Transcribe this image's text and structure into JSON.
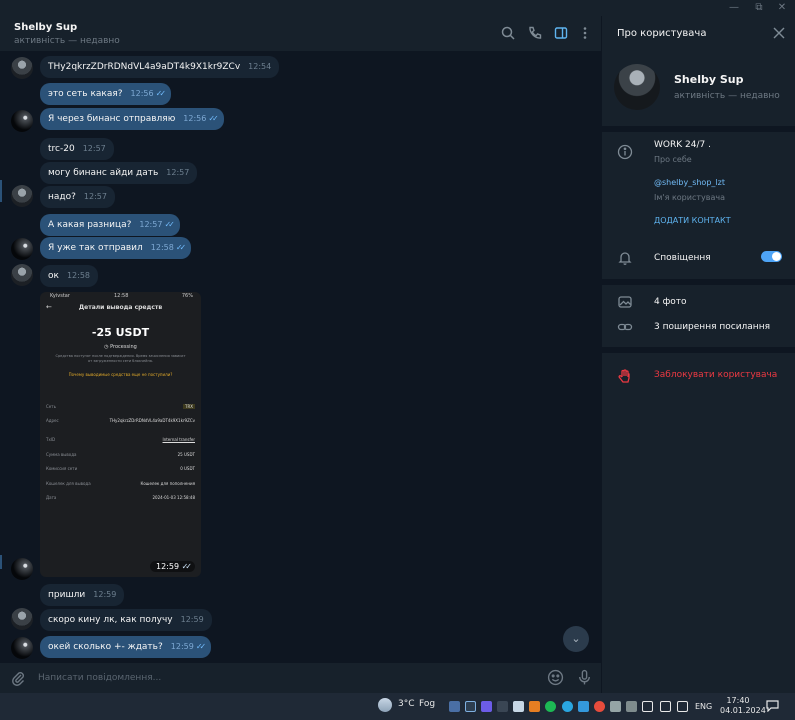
{
  "window": {
    "minimize_label": "—",
    "maximize_label": "⧉",
    "close_label": "✕"
  },
  "chat": {
    "name": "Shelby Sup",
    "status": "активність — недавно"
  },
  "messages": [
    {
      "side": "in",
      "text": "THy2qkrzZDrRDNdVL4a9aDT4k9X1kr9ZCv",
      "time": "12:54"
    },
    {
      "side": "out",
      "text": "это сеть какая?",
      "time": "12:56"
    },
    {
      "side": "out",
      "text": "Я через бинанс отправляю",
      "time": "12:56"
    },
    {
      "side": "in",
      "text": "trc-20",
      "time": "12:57"
    },
    {
      "side": "in",
      "text": "могу бинанс айди дать",
      "time": "12:57"
    },
    {
      "side": "in",
      "text": "надо?",
      "time": "12:57"
    },
    {
      "side": "out",
      "text": "А какая разница?",
      "time": "12:57"
    },
    {
      "side": "out",
      "text": "Я уже так отправил",
      "time": "12:58"
    },
    {
      "side": "in",
      "text": "ок",
      "time": "12:58"
    },
    {
      "side": "in",
      "text": "пришли",
      "time": "12:59"
    },
    {
      "side": "in",
      "text": "скоро кину лк, как получу",
      "time": "12:59"
    },
    {
      "side": "out",
      "text": "окей сколько +- ждать?",
      "time": "12:59"
    }
  ],
  "photo": {
    "status_left": "Kyivstar",
    "status_time": "12:58",
    "status_right": "76%",
    "title": "Детали вывода средств",
    "amount": "-25 USDT",
    "state": "Processing",
    "note": "Средства поступят после подтверждения. Время зачисления зависит от загруженности сети блокчейна.",
    "warning": "Почему выводимые средства еще не поступили?",
    "rows": [
      {
        "label": "Сеть",
        "value": "TRX"
      },
      {
        "label": "Адрес",
        "value": "THy2qkrzZDrRDNdVL4a9aDT4k9X1kr9ZCv"
      },
      {
        "label": "TxID",
        "value": "Internal transfer"
      },
      {
        "label": "Сумма вывода",
        "value": "25 USDT"
      },
      {
        "label": "Комиссия сети",
        "value": "0 USDT"
      },
      {
        "label": "Кошелек для вывода",
        "value": "Кошелек для пополнения"
      },
      {
        "label": "Дата",
        "value": "2024-01-03 12:58:48"
      }
    ],
    "time": "12:59"
  },
  "scroll_down_icon": "chevron-down-icon",
  "composer": {
    "placeholder": "Написати повідомлення..."
  },
  "sidebar": {
    "title": "Про користувача",
    "profile_name": "Shelby Sup",
    "profile_status": "активність — недавно",
    "bio": "WORK 24/7 .",
    "bio_label": "Про себе",
    "username": "@shelby_shop_lzt",
    "username_label": "Ім'я користувача",
    "add_contact": "ДОДАТИ КОНТАКТ",
    "notifications": "Сповіщення",
    "notifications_on": true,
    "photos": "4 фото",
    "links": "3 поширення посилання",
    "block": "Заблокувати користувача"
  },
  "taskbar": {
    "temperature": "3°C",
    "weather": "Fog",
    "language": "ENG",
    "time": "17:40",
    "date": "04.01.2024"
  },
  "colors": {
    "background": "#0e1621",
    "panel": "#17212b",
    "outgoing_bubble": "#2b5278",
    "incoming_bubble": "#182533",
    "accent": "#5fb4f0",
    "danger": "#ec3942"
  }
}
